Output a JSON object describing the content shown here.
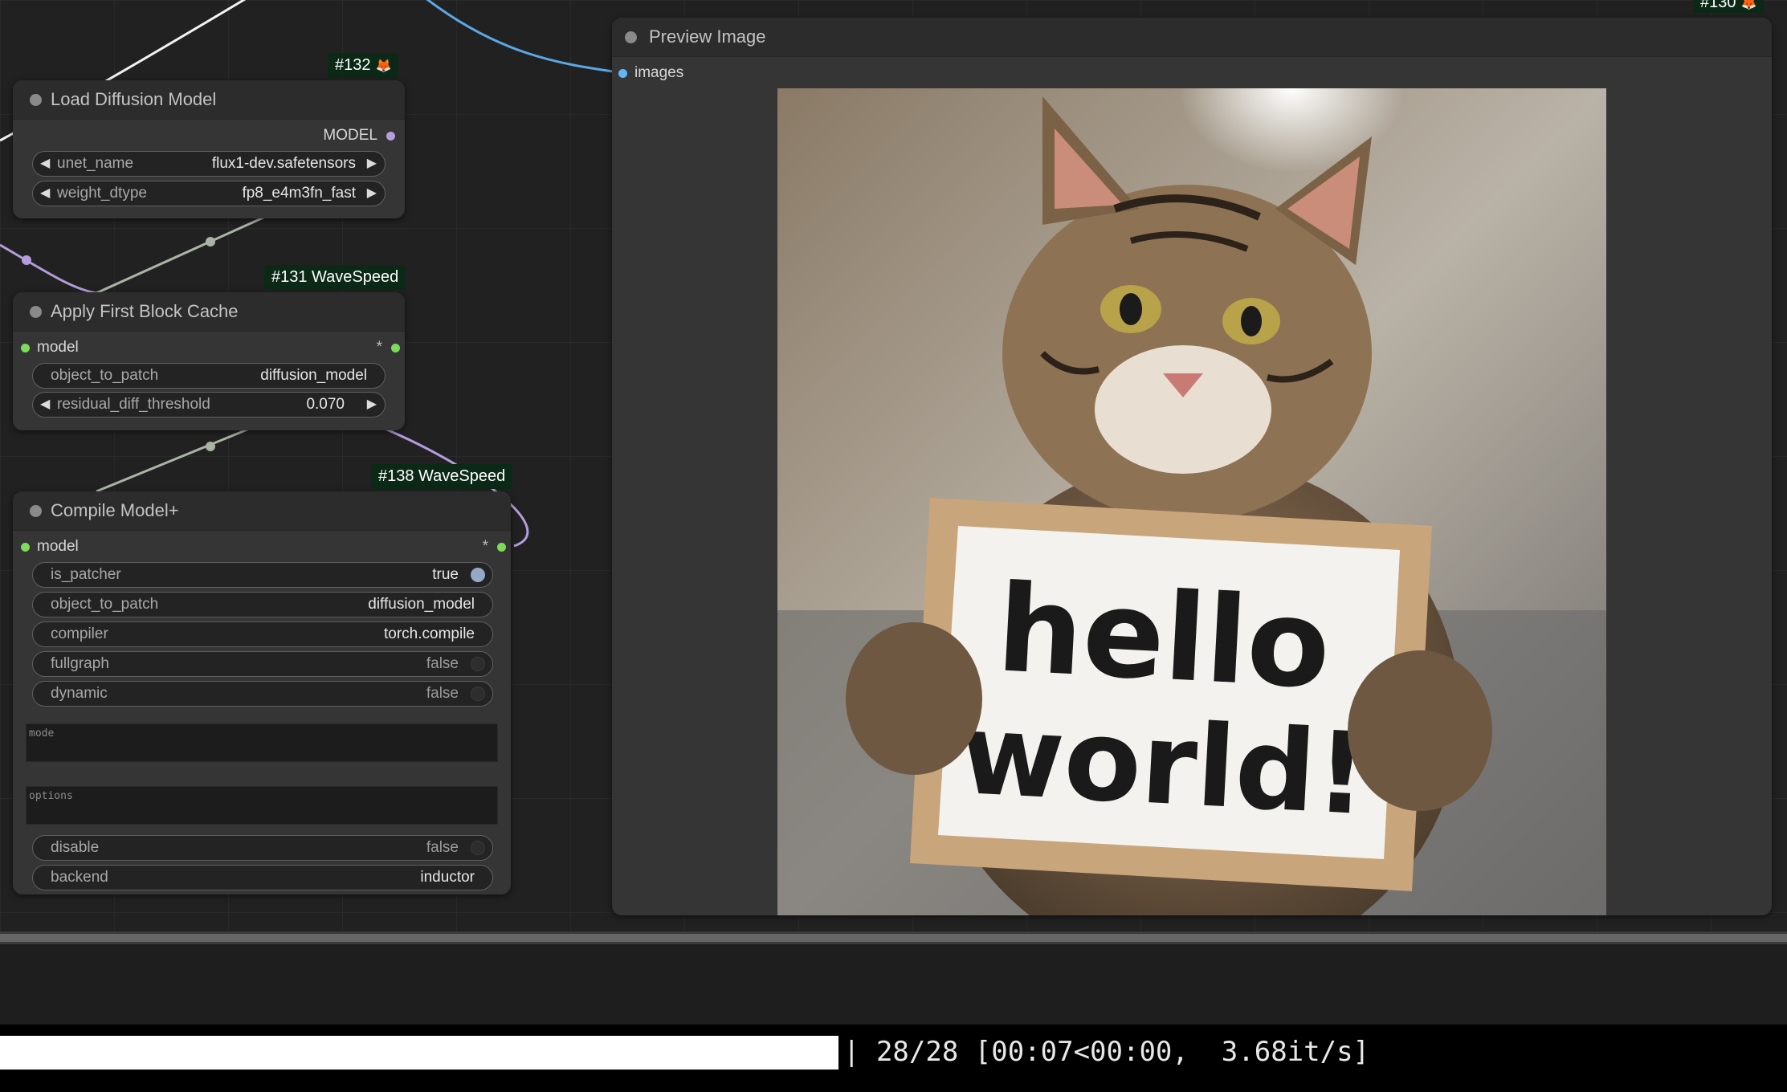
{
  "nodes": {
    "load_diffusion": {
      "badge": "#132",
      "title": "Load Diffusion Model",
      "output": "MODEL",
      "widgets": [
        {
          "label": "unet_name",
          "value": "flux1-dev.safetensors"
        },
        {
          "label": "weight_dtype",
          "value": "fp8_e4m3fn_fast"
        }
      ]
    },
    "first_block_cache": {
      "badge": "#131 WaveSpeed",
      "title": "Apply First Block Cache",
      "input": "model",
      "output": "*",
      "widgets": [
        {
          "label": "object_to_patch",
          "value": "diffusion_model"
        },
        {
          "label": "residual_diff_threshold",
          "value": "0.070"
        }
      ]
    },
    "compile_model": {
      "badge": "#138 WaveSpeed",
      "title": "Compile Model+",
      "input": "model",
      "output": "*",
      "widgets": [
        {
          "label": "is_patcher",
          "value": "true"
        },
        {
          "label": "object_to_patch",
          "value": "diffusion_model"
        },
        {
          "label": "compiler",
          "value": "torch.compile"
        },
        {
          "label": "fullgraph",
          "value": "false"
        },
        {
          "label": "dynamic",
          "value": "false"
        },
        {
          "label": "disable",
          "value": "false"
        },
        {
          "label": "backend",
          "value": "inductor"
        }
      ],
      "textareas": [
        {
          "placeholder": "mode"
        },
        {
          "placeholder": "options"
        }
      ]
    },
    "preview": {
      "badge": "#130",
      "title": "Preview Image",
      "input": "images",
      "image_sign_line1": "hello",
      "image_sign_line2": "world!"
    }
  },
  "progress": {
    "fraction": 1.0,
    "text": "| 28/28 [00:07<00:00,  3.68it/s]"
  },
  "colors": {
    "model_link": "#b39ddb",
    "image_link": "#64b5f6",
    "output_green": "#7cdc5a"
  }
}
